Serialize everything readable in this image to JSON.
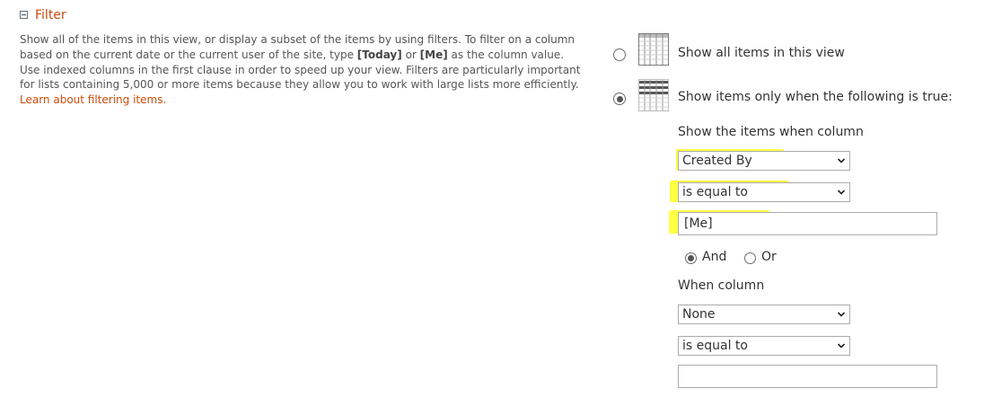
{
  "section": {
    "title": "Filter"
  },
  "description": {
    "part1": "Show all of the items in this view, or display a subset of the items by using filters. To filter on a column based on the current date or the current user of the site, type ",
    "today_token": "[Today]",
    "or_text": " or ",
    "me_token": "[Me]",
    "part2": " as the column value. Use indexed columns in the first clause in order to speed up your view. Filters are particularly important for lists containing 5,000 or more items because they allow you to work with large lists more efficiently. ",
    "learn_link": "Learn about filtering items."
  },
  "options": {
    "show_all_label": "Show all items in this view",
    "show_filtered_label": "Show items only when the following is true:",
    "selected": "show_filtered"
  },
  "clause1": {
    "heading": "Show the items when column",
    "column": "Created By",
    "operator": "is equal to",
    "value": "[Me]"
  },
  "connector": {
    "and_label": "And",
    "or_label": "Or",
    "selected": "And"
  },
  "clause2": {
    "heading": "When column",
    "column": "None",
    "operator": "is equal to",
    "value": ""
  },
  "colors": {
    "accent": "#c94b0c",
    "highlight": "#ffff33"
  }
}
